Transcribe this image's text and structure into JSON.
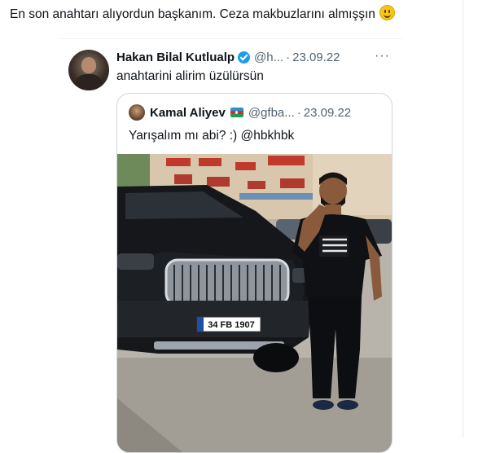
{
  "reply_text": "En son anahtarı alıyordun başkanım. Ceza makbuzlarını almışşın",
  "emoji": "smiling-face-emoji",
  "tweet": {
    "author_name": "Hakan Bilal Kutlualp",
    "handle": "@h...",
    "separator": "·",
    "date": "23.09.22",
    "more": "···",
    "text": "anahtarini alirim üzülürsün"
  },
  "quoted": {
    "author_name": "Kamal Aliyev",
    "handle": "@gfba...",
    "separator": "·",
    "date": "23.09.22",
    "text": "Yarışalım mı abi? :) @hbkhbk",
    "plate": "34 FB 1907"
  },
  "colors": {
    "text": "#0f1419",
    "muted": "#536471",
    "verified": "#1d9bf0",
    "border": "#cfd9de"
  }
}
